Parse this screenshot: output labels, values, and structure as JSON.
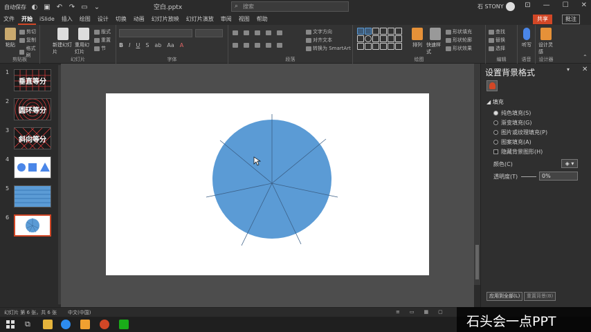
{
  "titlebar": {
    "autosave": "自动保存",
    "filename": "空白.pptx",
    "search_placeholder": "搜索",
    "user": "石 STONY",
    "ribbon_display_icon": "ribbon-display-icon"
  },
  "tabs": [
    "文件",
    "开始",
    "iSlide",
    "插入",
    "绘图",
    "设计",
    "切换",
    "动画",
    "幻灯片放映",
    "幻灯片演放",
    "审阅",
    "视图",
    "帮助"
  ],
  "active_tab": "开始",
  "share_label": "共享",
  "comment_label": "批注",
  "ribbon": {
    "groups": [
      "剪贴板",
      "幻灯片",
      "字体",
      "段落",
      "绘图",
      "编辑",
      "语音",
      "设计器"
    ],
    "paste": "粘贴",
    "new_slide": "新建幻灯片",
    "reuse_slide": "重用幻灯片",
    "layout": "版式",
    "reset": "重置",
    "section": "节",
    "cut": "剪切",
    "copy": "复制",
    "format_painter": "格式刷",
    "arrange": "排列",
    "quick_styles": "快速样式",
    "shape_fill": "形状填充",
    "shape_outline": "形状轮廓",
    "shape_effects": "形状效果",
    "find": "查找",
    "replace": "替换",
    "select": "选择",
    "dictate": "听写",
    "design_ideas": "设计灵感",
    "text_direction": "文字方向",
    "align_text": "对齐文本",
    "smartart": "转换为 SmartArt"
  },
  "slides": [
    {
      "num": "1",
      "title": "垂直等分"
    },
    {
      "num": "2",
      "title": "圆环等分"
    },
    {
      "num": "3",
      "title": "斜向等分"
    },
    {
      "num": "4",
      "title": ""
    },
    {
      "num": "5",
      "title": ""
    },
    {
      "num": "6",
      "title": ""
    }
  ],
  "selected_slide": 6,
  "format_pane": {
    "title": "设置背景格式",
    "section": "填充",
    "options": [
      "纯色填充(S)",
      "渐变填充(G)",
      "图片或纹理填充(P)",
      "图案填充(A)",
      "隐藏背景图形(H)"
    ],
    "selected_option": 0,
    "color_label": "颜色(C)",
    "transparency_label": "透明度(T)",
    "transparency_value": "0%",
    "apply_all": "应用到全部(L)",
    "reset_bg": "重置背景(B)"
  },
  "statusbar": {
    "slide_info": "幻灯片 第 6 张，共 6 张",
    "language": "中文(中国)"
  },
  "watermark": "石头会一点PPT",
  "colors": {
    "accent": "#d24726",
    "circle_fill": "#5b9bd5",
    "slide_bg": "#ffffff"
  }
}
